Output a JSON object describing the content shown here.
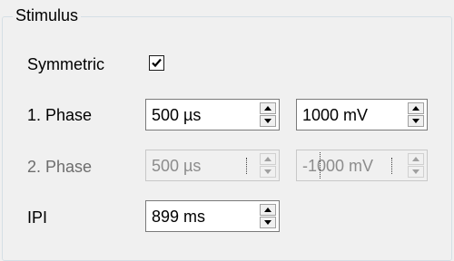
{
  "group": {
    "title": "Stimulus"
  },
  "symmetric": {
    "label": "Symmetric",
    "checked": true
  },
  "phase1": {
    "label": "1. Phase",
    "duration": "500 µs",
    "amplitude": "1000 mV"
  },
  "phase2": {
    "label": "2. Phase",
    "duration": "500 µs",
    "amplitude": "-1000 mV",
    "enabled": false
  },
  "ipi": {
    "label": "IPI",
    "value": "899 ms"
  },
  "icons": {
    "check": "checkmark-icon",
    "up": "arrow-up-icon",
    "down": "arrow-down-icon"
  }
}
